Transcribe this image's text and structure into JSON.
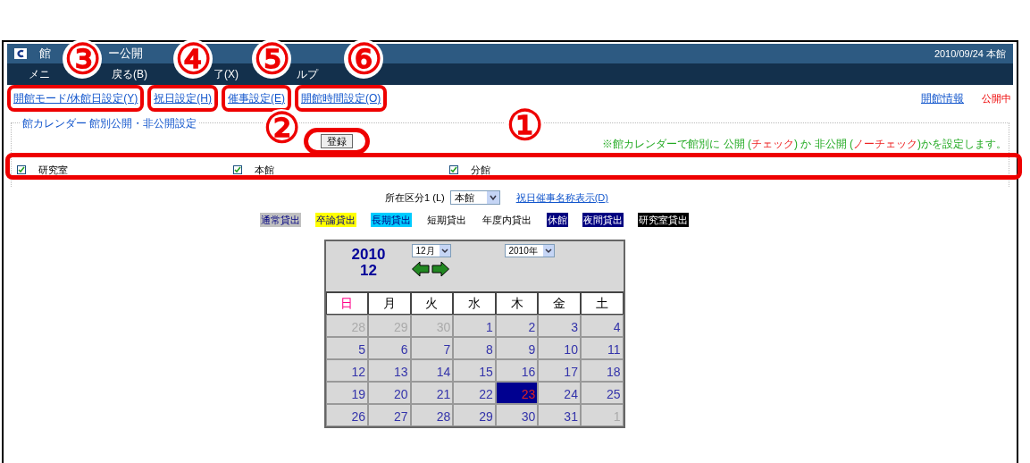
{
  "header": {
    "title_parts": [
      "館",
      "ー公開"
    ],
    "date_site": "2010/09/24 本館",
    "menu": [
      "メニ",
      "戻る(B)",
      "了(X)",
      "ルプ"
    ]
  },
  "links": [
    "開館モード/休館日設定(Y)",
    "祝日設定(H)",
    "催事設定(E)",
    "開館時間設定(O)"
  ],
  "right_links": {
    "info": "開館情報",
    "status": "公開中"
  },
  "section": {
    "title": "館カレンダー  館別公開・非公開設定",
    "register_button": "登録",
    "note": [
      {
        "text": "※館カレンダーで館別に 公開 (",
        "red": false
      },
      {
        "text": "チェック",
        "red": true
      },
      {
        "text": ") か 非公開 (",
        "red": false
      },
      {
        "text": "ノーチェック",
        "red": true
      },
      {
        "text": ")かを設定します。",
        "red": false
      }
    ],
    "branches": [
      {
        "label": "研究室",
        "checked": true
      },
      {
        "label": "本館",
        "checked": true
      },
      {
        "label": "分館",
        "checked": true
      }
    ]
  },
  "location": {
    "label": "所在区分1 (L)",
    "value": "本館",
    "link": "祝日催事名称表示(D)"
  },
  "legend": [
    {
      "label": "通常貸出",
      "color": "#c0c0c0"
    },
    {
      "label": "卒論貸出",
      "color": "#ffff00"
    },
    {
      "label": "長期貸出",
      "color": "#00ccff"
    },
    {
      "label": "短期貸出"
    },
    {
      "label": "年度内貸出"
    },
    {
      "label": "休館",
      "color": "#000080"
    },
    {
      "label": "夜間貸出",
      "color": "#000080"
    },
    {
      "label": "研究室貸出",
      "color": "#000000"
    }
  ],
  "calendar": {
    "year": "2010",
    "month": "12",
    "month_select": "12月",
    "year_select": "2010年",
    "weekdays": [
      {
        "label": "日",
        "sunday": true
      },
      {
        "label": "月",
        "sunday": false
      },
      {
        "label": "火",
        "sunday": false
      },
      {
        "label": "水",
        "sunday": false
      },
      {
        "label": "木",
        "sunday": false
      },
      {
        "label": "金",
        "sunday": false
      },
      {
        "label": "土",
        "sunday": false
      }
    ],
    "weeks": [
      [
        {
          "day": "28",
          "other": true
        },
        {
          "day": "29",
          "other": true
        },
        {
          "day": "30",
          "other": true
        },
        {
          "day": "1",
          "other": false
        },
        {
          "day": "2",
          "other": false
        },
        {
          "day": "3",
          "other": false
        },
        {
          "day": "4",
          "other": false
        }
      ],
      [
        {
          "day": "5",
          "other": false
        },
        {
          "day": "6",
          "other": false
        },
        {
          "day": "7",
          "other": false
        },
        {
          "day": "8",
          "other": false
        },
        {
          "day": "9",
          "other": false
        },
        {
          "day": "10",
          "other": false
        },
        {
          "day": "11",
          "other": false
        }
      ],
      [
        {
          "day": "12",
          "other": false
        },
        {
          "day": "13",
          "other": false
        },
        {
          "day": "14",
          "other": false
        },
        {
          "day": "15",
          "other": false
        },
        {
          "day": "16",
          "other": false
        },
        {
          "day": "17",
          "other": false
        },
        {
          "day": "18",
          "other": false
        }
      ],
      [
        {
          "day": "19",
          "other": false
        },
        {
          "day": "20",
          "other": false
        },
        {
          "day": "21",
          "other": false
        },
        {
          "day": "22",
          "other": false
        },
        {
          "day": "23",
          "other": false,
          "selected": true
        },
        {
          "day": "24",
          "other": false
        },
        {
          "day": "25",
          "other": false
        }
      ],
      [
        {
          "day": "26",
          "other": false
        },
        {
          "day": "27",
          "other": false
        },
        {
          "day": "28",
          "other": false
        },
        {
          "day": "29",
          "other": false
        },
        {
          "day": "30",
          "other": false
        },
        {
          "day": "31",
          "other": false
        },
        {
          "day": "1",
          "other": true
        }
      ]
    ]
  },
  "annotations": [
    {
      "number": "③"
    },
    {
      "number": "④"
    },
    {
      "number": "⑤"
    },
    {
      "number": "⑥"
    },
    {
      "number": "②"
    },
    {
      "number": "①"
    }
  ]
}
